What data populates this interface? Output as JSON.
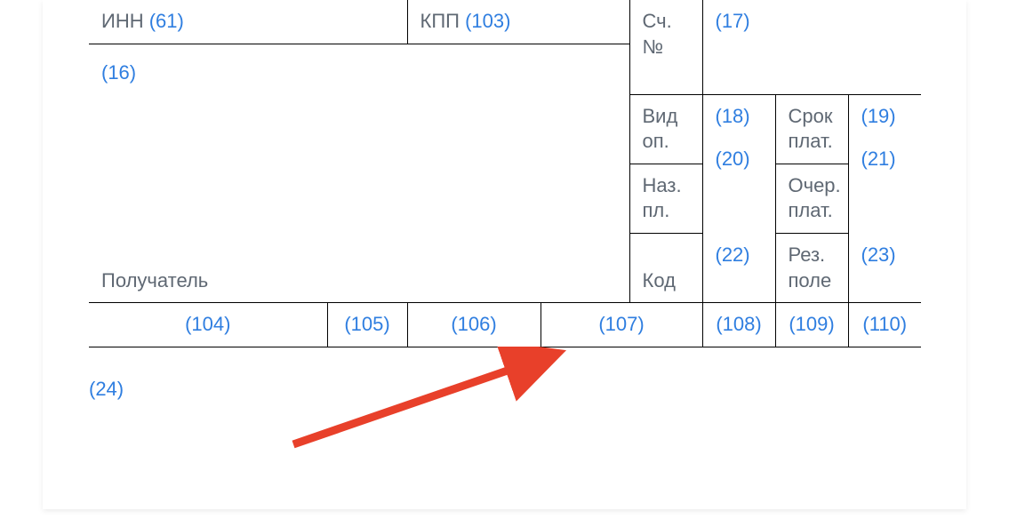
{
  "row1": {
    "inn_label": "ИНН",
    "inn_ref": "(61)",
    "kpp_label": "КПП",
    "kpp_ref": "(103)",
    "sch_label": "Сч. №",
    "sch_ref": "(17)"
  },
  "row1b": {
    "ref16": "(16)"
  },
  "row2": {
    "vid_label": "Вид оп.",
    "vid_ref": "(18)",
    "srok_label": "Срок плат.",
    "srok_ref": "(19)"
  },
  "row3": {
    "naz_label": "Наз. пл.",
    "naz_ref": "(20)",
    "ocher_label": "Очер. плат.",
    "ocher_ref": "(21)"
  },
  "row4": {
    "recipient_label": "Получатель",
    "kod_label": "Код",
    "kod_ref": "(22)",
    "rez_label": "Рез. поле",
    "rez_ref": "(23)"
  },
  "bottom": {
    "c104": "(104)",
    "c105": "(105)",
    "c106": "(106)",
    "c107": "(107)",
    "c108": "(108)",
    "c109": "(109)",
    "c110": "(110)"
  },
  "footer": {
    "ref24": "(24)"
  }
}
